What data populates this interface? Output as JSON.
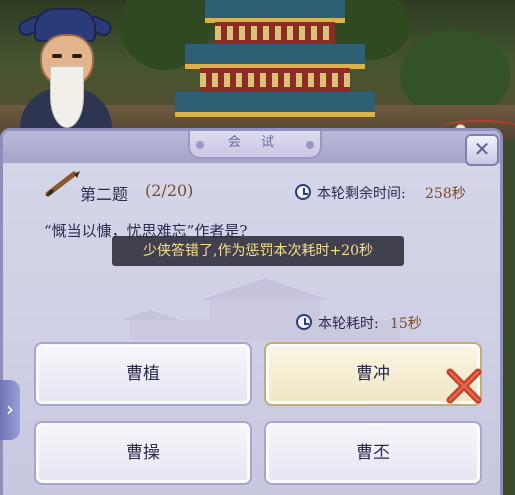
{
  "dialog": {
    "title": "会 试",
    "close_symbol": "✕"
  },
  "question": {
    "number_label": "第二题",
    "progress": "(2/20)",
    "text": "“慨当以慷，忧思难忘”作者是?"
  },
  "timer": {
    "remaining_label": "本轮剩余时间:",
    "remaining_value": "258秒",
    "used_label": "本轮耗时:",
    "used_value": "15秒"
  },
  "toast": {
    "message": "少侠答错了,作为惩罚本次耗时+20秒"
  },
  "answers": [
    {
      "label": "曹植"
    },
    {
      "label": "曹冲",
      "selected": true,
      "wrong": true
    },
    {
      "label": "曹操"
    },
    {
      "label": "曹丕"
    }
  ],
  "side_nav": {
    "arrow": "›"
  },
  "colors": {
    "panel": "#cfcfe5",
    "accent_text": "#7a4b2a",
    "toast_text": "#f7e08a",
    "wrong_mark": "#c8402c"
  },
  "icons": [
    "clock-icon",
    "brush-icon",
    "close-icon",
    "wrong-x-icon",
    "chevron-right-icon"
  ]
}
